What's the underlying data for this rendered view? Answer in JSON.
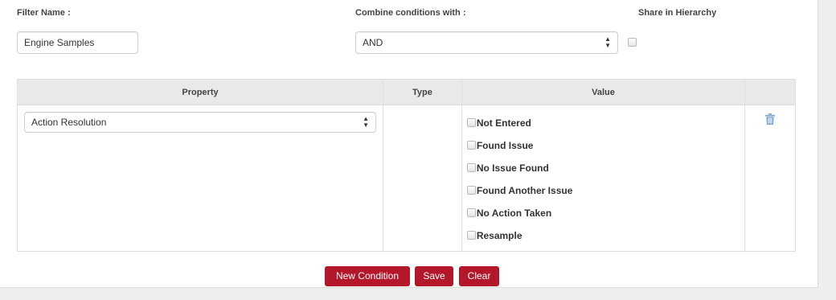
{
  "filter_name": {
    "label": "Filter Name :",
    "value": "Engine Samples"
  },
  "combine": {
    "label": "Combine conditions with :",
    "selected": "AND"
  },
  "share": {
    "label": "Share in Hierarchy",
    "checked": false
  },
  "table": {
    "headers": [
      "Property",
      "Type",
      "Value",
      ""
    ],
    "row": {
      "property": "Action Resolution",
      "type": "",
      "values": [
        "Not Entered",
        "Found Issue",
        "No Issue Found",
        "Found Another Issue",
        "No Action Taken",
        "Resample"
      ]
    }
  },
  "buttons": {
    "new_condition": "New Condition",
    "save": "Save",
    "clear": "Clear"
  },
  "colors": {
    "button_bg": "#b5172a",
    "header_bg": "#e9e9e9",
    "trash_icon": "#7fa6d0"
  },
  "icons": {
    "delete": "trash-icon",
    "select_arrows": "up-down-chevron-icon"
  }
}
